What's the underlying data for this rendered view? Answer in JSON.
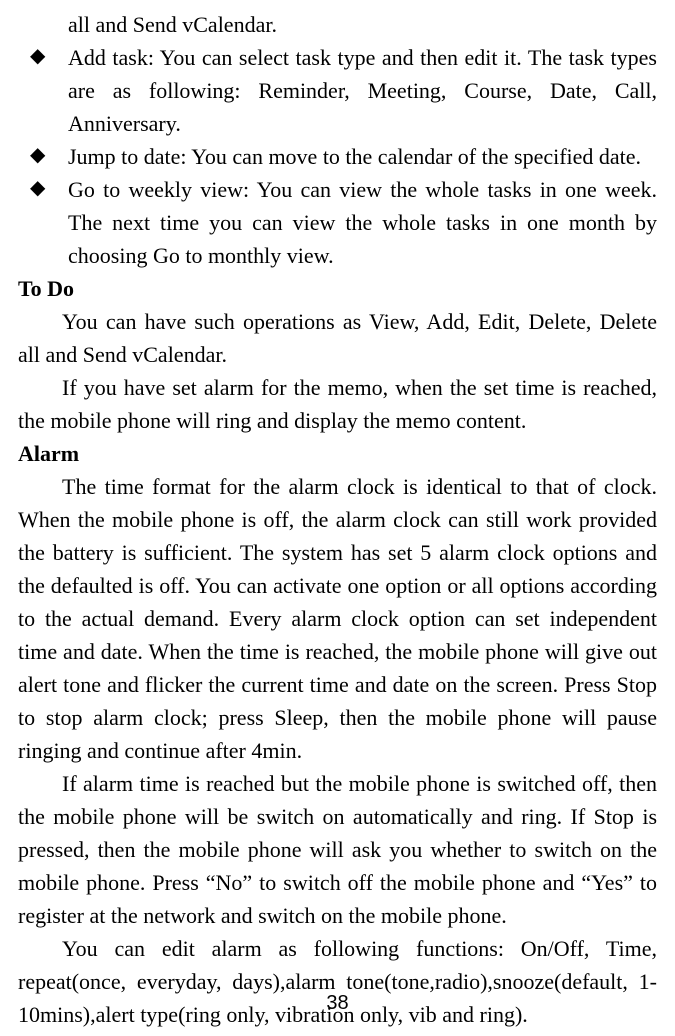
{
  "line_top": "all and Send vCalendar.",
  "bullets": [
    "Add task: You can select task type and then edit it. The task types are as following: Reminder, Meeting, Course, Date, Call, Anniversary.",
    "Jump to date: You can move to the calendar of the specified date.",
    "Go to weekly view: You can view the whole tasks in one week. The next time you can view the whole tasks in one month by choosing Go to monthly view."
  ],
  "todo": {
    "heading": "To Do",
    "para1": "You can have such operations as View, Add, Edit, Delete, Delete all and Send vCalendar.",
    "para2": "If you have set alarm for the memo, when the set time is reached, the mobile phone will ring and display the memo content."
  },
  "alarm": {
    "heading": "Alarm",
    "para1": "The time format for the alarm clock is identical to that of clock. When the mobile phone is off, the alarm clock can still work provided the battery is sufficient. The system has set 5 alarm clock options and the defaulted is off. You can activate one option or all options according to the actual demand. Every alarm clock option can set independent time and date. When the time is reached, the mobile phone will give out alert tone and flicker the current time and date on the screen. Press Stop to stop alarm clock; press Sleep, then the mobile phone will pause ringing and continue after 4min.",
    "para2": "If alarm time is reached but the mobile phone is switched off, then the mobile phone will be switch on automatically and ring. If Stop is pressed, then the mobile phone will ask you whether to switch on the mobile phone. Press “No” to switch off the mobile phone and “Yes” to register at the network and switch on the mobile phone.",
    "para3": "You can edit alarm as following functions: On/Off, Time, repeat(once, everyday, days),alarm tone(tone,radio),snooze(default, 1-10mins),alert type(ring only, vibration only, vib and ring)."
  },
  "page_number": "38"
}
